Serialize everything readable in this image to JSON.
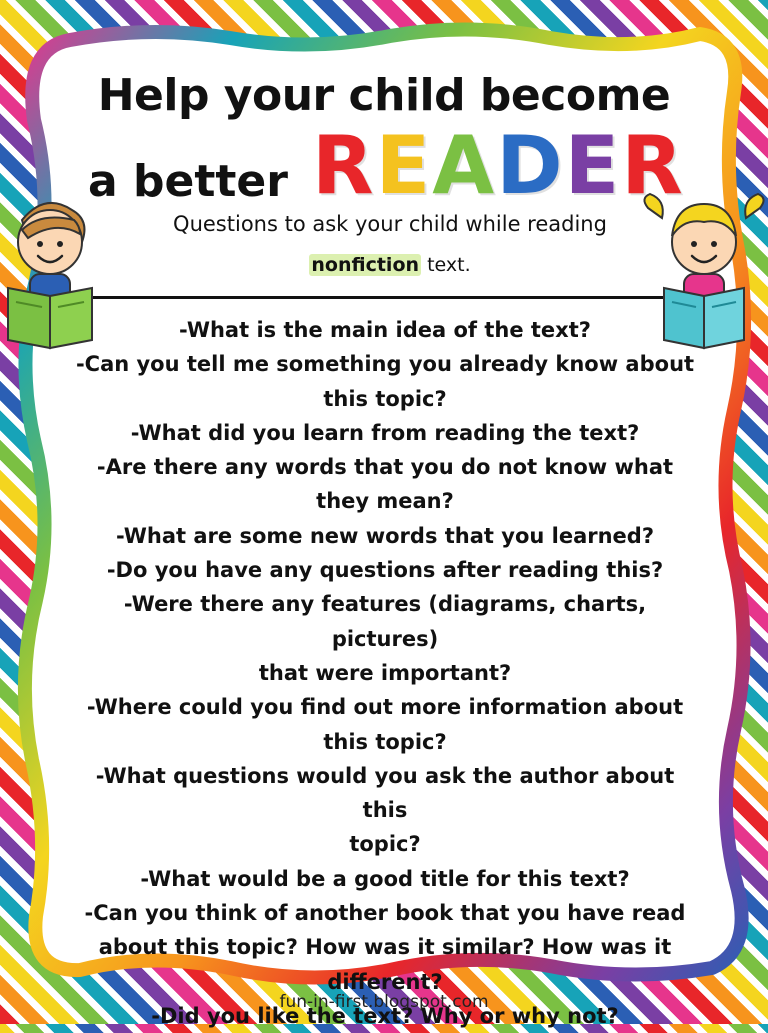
{
  "title": {
    "line1": "Help your child become",
    "line2_prefix": "a better",
    "reader_letters": [
      "R",
      "E",
      "A",
      "D",
      "E",
      "R"
    ],
    "reader_colors": [
      "#e8262a",
      "#f4c21f",
      "#7bc043",
      "#2b6cc4",
      "#7a3fa4",
      "#e8262a"
    ]
  },
  "subtitle": {
    "line1": "Questions to ask your child while reading",
    "highlight": "nonfiction",
    "line2_suffix": " text."
  },
  "questions": [
    "-What is the main idea of the text?",
    "-Can you tell me something you already know about",
    "this topic?",
    "-What did you learn from reading the text?",
    "-Are there any words that you do not know what",
    "they mean?",
    "-What are some new words that you learned?",
    "-Do you have any questions after reading this?",
    "-Were there any features (diagrams, charts, pictures)",
    "that were important?",
    "-Where could you find out more information about",
    "this topic?",
    "-What questions would you ask the author about this",
    "topic?",
    "-What would be a good title for this text?",
    "-Can you think of another book that you have read",
    "about this topic?  How was it similar?  How was it",
    "different?",
    "-Did you like the text?  Why or why not?"
  ],
  "footer": "fun-in-first.blogspot.com",
  "icons": {
    "left": "boy-reading-icon",
    "right": "girl-reading-icon"
  },
  "colors": {
    "frame_fill": "#ffffff",
    "frame_border_gradient": [
      "#e8262a",
      "#f7941d",
      "#f4d51f",
      "#7bc043",
      "#17a3b8",
      "#2b5fb4",
      "#7a3fa4",
      "#e6358c"
    ]
  }
}
